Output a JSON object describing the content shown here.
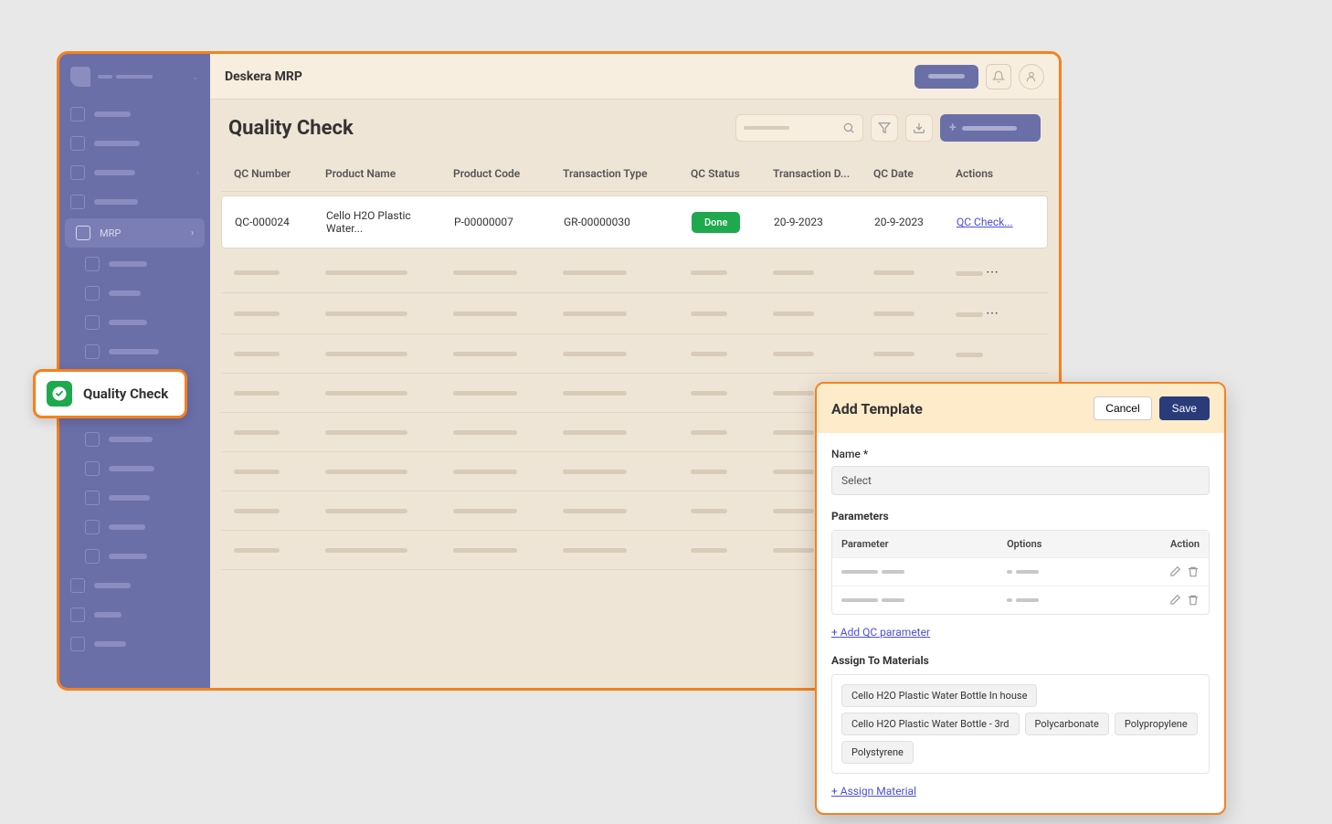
{
  "topbar": {
    "title": "Deskera MRP"
  },
  "sidebar": {
    "active_label": "MRP"
  },
  "page": {
    "title": "Quality Check"
  },
  "table": {
    "headers": {
      "qc_number": "QC Number",
      "product_name": "Product Name",
      "product_code": "Product Code",
      "transaction_type": "Transaction Type",
      "qc_status": "QC Status",
      "transaction_date": "Transaction D...",
      "qc_date": "QC Date",
      "actions": "Actions"
    },
    "row": {
      "qc_number": "QC-000024",
      "product_name": "Cello H2O Plastic Water...",
      "product_code": "P-00000007",
      "transaction_type": "GR-00000030",
      "qc_status": "Done",
      "transaction_date": "20-9-2023",
      "qc_date": "20-9-2023",
      "action_link": "QC Check..."
    }
  },
  "callout": {
    "label": "Quality Check"
  },
  "modal": {
    "title": "Add Template",
    "cancel": "Cancel",
    "save": "Save",
    "name_label": "Name *",
    "name_value": "Select",
    "parameters_label": "Parameters",
    "param_headers": {
      "parameter": "Parameter",
      "options": "Options",
      "action": "Action"
    },
    "add_param_link": "+ Add QC parameter",
    "assign_label": "Assign To Materials",
    "materials": [
      "Cello H2O Plastic Water Bottle In house",
      "Cello H2O Plastic Water Bottle - 3rd",
      "Polycarbonate",
      "Polypropylene",
      "Polystyrene"
    ],
    "assign_link": "+ Assign Material"
  }
}
